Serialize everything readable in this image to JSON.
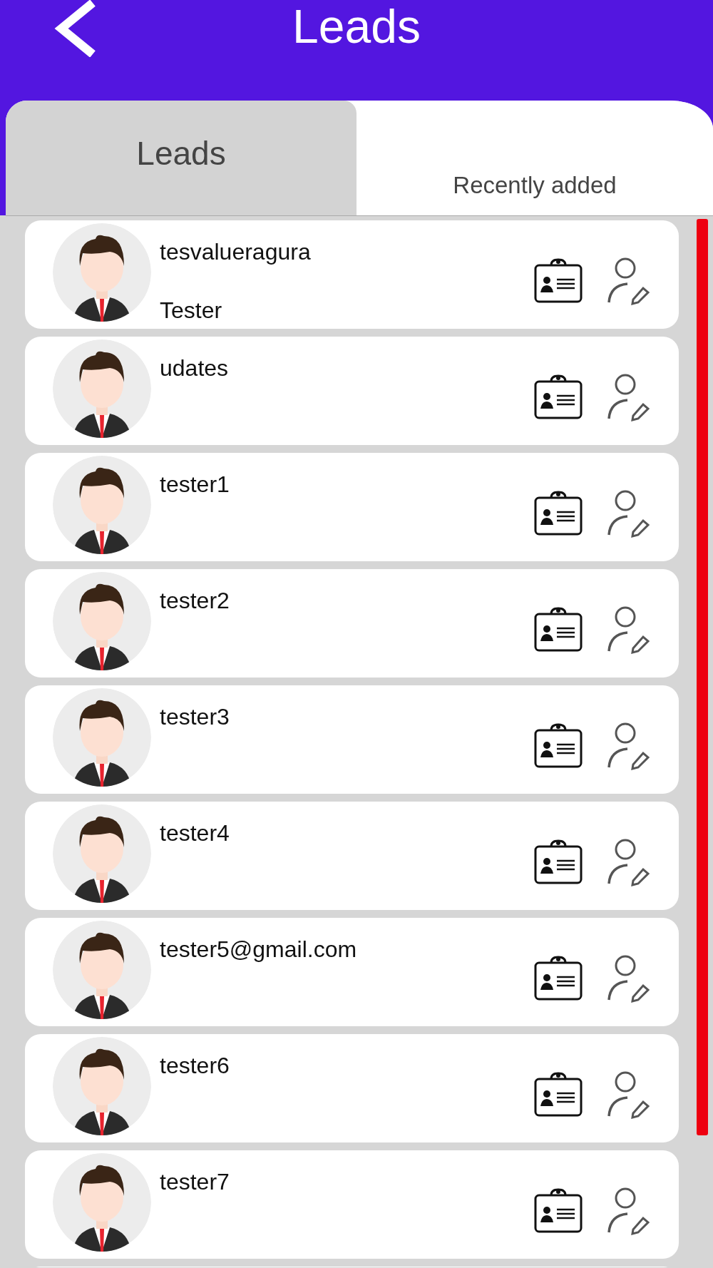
{
  "header": {
    "title": "Leads"
  },
  "tabs": [
    {
      "label": "Leads",
      "selected": true
    },
    {
      "label": "Recently added",
      "selected": false
    }
  ],
  "leads": [
    {
      "name": "tesvalueragura",
      "subtitle": "Tester"
    },
    {
      "name": "udates"
    },
    {
      "name": "tester1"
    },
    {
      "name": "tester2"
    },
    {
      "name": "tester3"
    },
    {
      "name": "tester4"
    },
    {
      "name": "tester5@gmail.com"
    },
    {
      "name": "tester6"
    },
    {
      "name": "tester7"
    }
  ]
}
